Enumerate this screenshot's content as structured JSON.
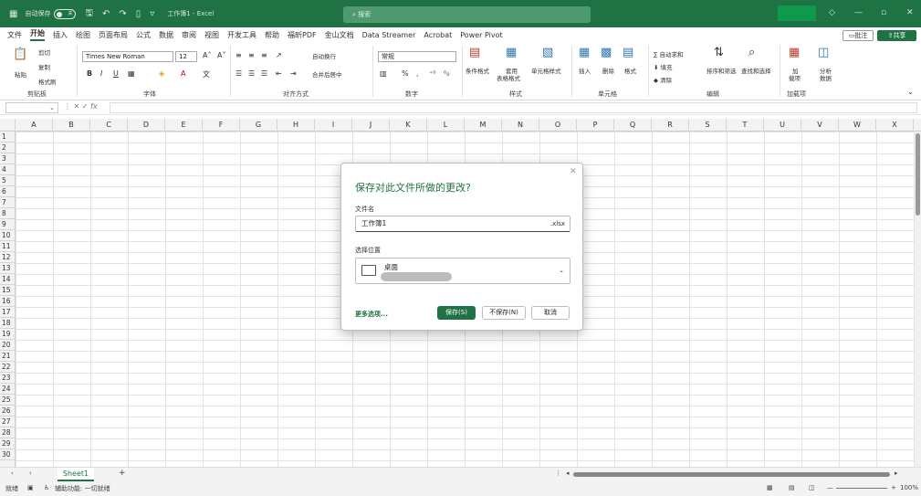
{
  "titlebar": {
    "autosave_label": "自动保存",
    "autosave_state": "关",
    "doc_title": "工作簿1 - Excel",
    "search_placeholder": "搜索",
    "accent": "#1f7244",
    "icons": [
      "excel-logo-icon",
      "save-icon",
      "undo-icon",
      "redo-icon",
      "touch-mode-icon",
      "customize-icon"
    ],
    "win_min": "—",
    "win_restore": "▫",
    "win_close": "✕"
  },
  "menu": {
    "tabs": [
      "文件",
      "开始",
      "插入",
      "绘图",
      "页面布局",
      "公式",
      "数据",
      "审阅",
      "视图",
      "开发工具",
      "帮助",
      "福昕PDF",
      "金山文档",
      "Data Streamer",
      "Acrobat",
      "Power Pivot"
    ],
    "active": "开始",
    "comment": "批注",
    "share": "共享"
  },
  "ribbon": {
    "clipboard": {
      "paste": "粘贴",
      "cut": "剪切",
      "copy": "复制",
      "format_painter": "格式刷",
      "label": "剪贴板"
    },
    "font": {
      "name": "Times New Roman",
      "size": "12",
      "label": "字体"
    },
    "align": {
      "wrap": "自动换行",
      "merge": "合并后居中",
      "label": "对齐方式"
    },
    "number": {
      "format": "常规",
      "label": "数字"
    },
    "styles": {
      "cond": "条件格式",
      "table": "套用",
      "table2": "表格格式",
      "cell": "单元格样式",
      "label": "样式"
    },
    "cells": {
      "insert": "插入",
      "delete": "删除",
      "format": "格式",
      "label": "单元格"
    },
    "editing": {
      "autosum": "自动求和",
      "fill": "填充",
      "clear": "清除",
      "sort": "排序和筛选",
      "find": "查找和选择",
      "label": "编辑"
    },
    "addins": {
      "addin": "加",
      "addin2": "载项",
      "analyze": "分析",
      "analyze2": "数据",
      "label": "加载项"
    }
  },
  "formula_bar": {
    "fx": "fx"
  },
  "columns": [
    "A",
    "B",
    "C",
    "D",
    "E",
    "F",
    "G",
    "H",
    "I",
    "J",
    "K",
    "L",
    "M",
    "N",
    "O",
    "P",
    "Q",
    "R",
    "S",
    "T",
    "U",
    "V",
    "W",
    "X"
  ],
  "rows": [
    "1",
    "2",
    "3",
    "4",
    "5",
    "6",
    "7",
    "8",
    "9",
    "10",
    "11",
    "12",
    "13",
    "14",
    "15",
    "16",
    "17",
    "18",
    "19",
    "20",
    "21",
    "22",
    "23",
    "24",
    "25",
    "26",
    "27",
    "28",
    "29",
    "30"
  ],
  "sheet": {
    "name": "Sheet1",
    "add": "+"
  },
  "status": {
    "ready": "就绪",
    "accessibility": "辅助功能: 一切就绪",
    "zoom": "100%"
  },
  "dialog": {
    "title": "保存对此文件所做的更改?",
    "filename_label": "文件名",
    "filename": "工作簿1",
    "ext": ".xlsx",
    "location_label": "选择位置",
    "location": "桌面",
    "more": "更多选项...",
    "save": "保存(S)",
    "dont_save": "不保存(N)",
    "cancel": "取消"
  }
}
